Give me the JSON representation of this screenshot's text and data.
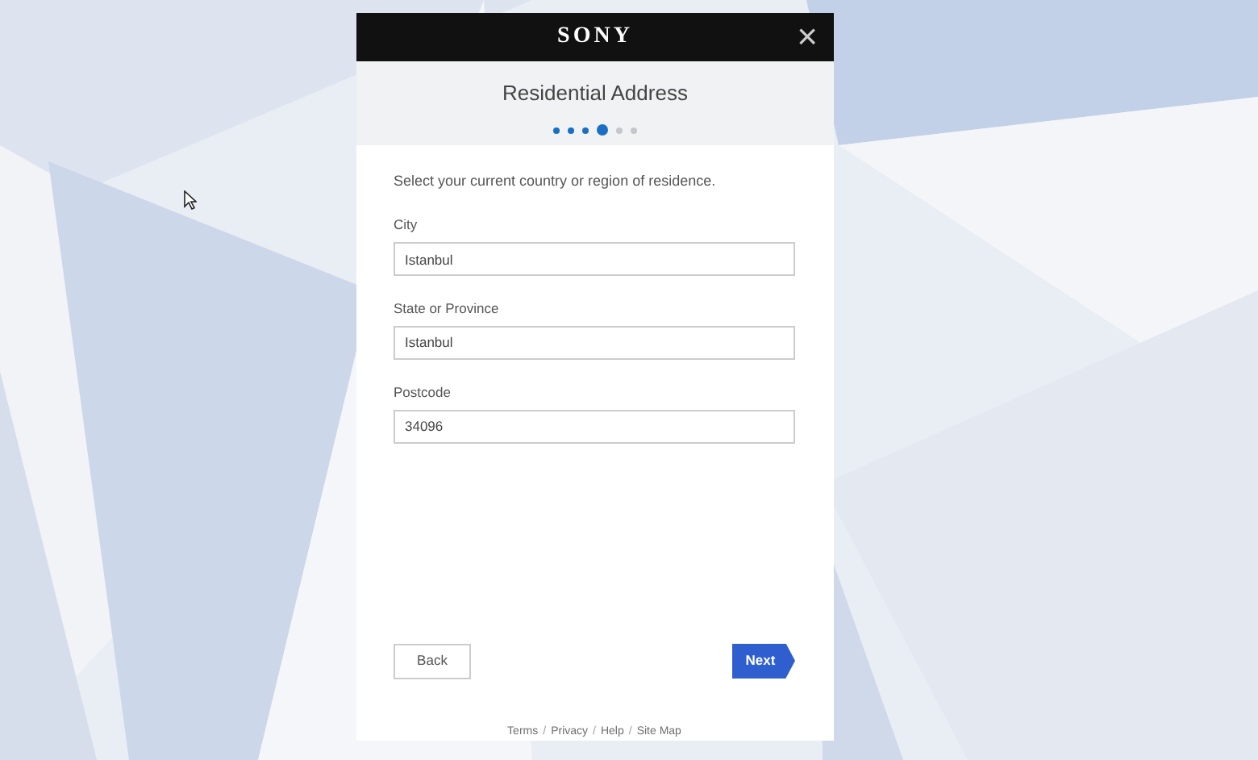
{
  "dialog": {
    "brand": "SONY",
    "close": "×",
    "title": "Residential Address",
    "steps": [
      {
        "completed": true,
        "selected": false
      },
      {
        "completed": true,
        "selected": false
      },
      {
        "completed": true,
        "selected": false
      },
      {
        "completed": true,
        "selected": true
      },
      {
        "completed": false,
        "selected": false
      },
      {
        "completed": false,
        "selected": false
      }
    ],
    "instruction": "Select your current country or region of residence.",
    "fields": [
      {
        "label": "City",
        "value": "Istanbul"
      },
      {
        "label": "State or Province",
        "value": "Istanbul"
      },
      {
        "label": "Postcode",
        "value": "34096"
      }
    ],
    "back_button": "Back",
    "next_button": "Next",
    "footer": [
      {
        "kind": "link",
        "text": "Terms"
      },
      {
        "kind": "separator",
        "text": "/"
      },
      {
        "kind": "link",
        "text": "Privacy"
      },
      {
        "kind": "separator",
        "text": "/"
      },
      {
        "kind": "link",
        "text": "Help"
      },
      {
        "kind": "separator",
        "text": "/"
      },
      {
        "kind": "link",
        "text": "Site Map"
      }
    ]
  }
}
